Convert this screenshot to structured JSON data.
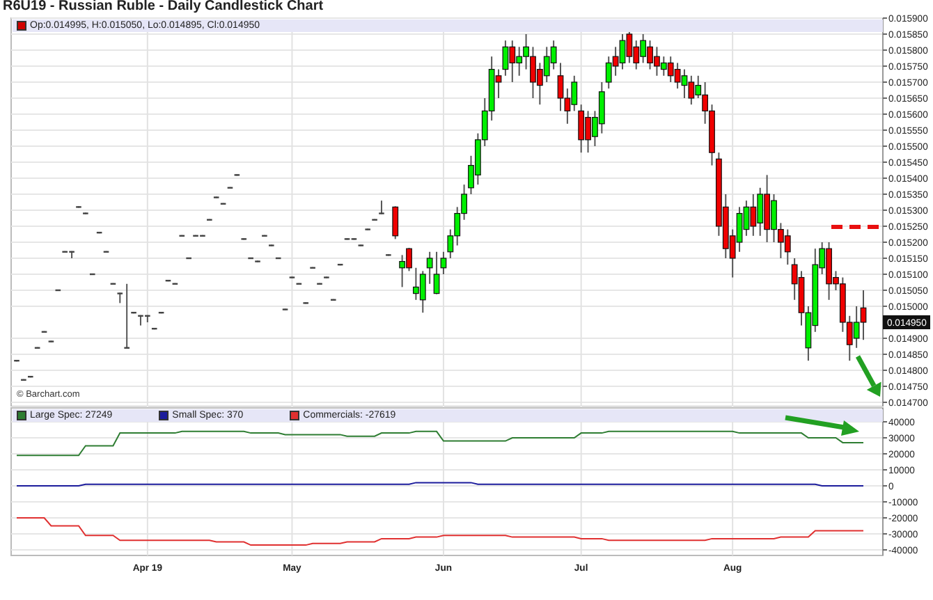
{
  "title": "R6U19 - Russian Ruble - Daily Candlestick Chart",
  "price_chart": {
    "readout": "Op:0.014995, H:0.015050, Lo:0.014895, Cl:0.014950",
    "credit": "© Barchart.com",
    "chart_data": {
      "type": "candlestick",
      "grid": true,
      "ylim": [
        0.0147,
        0.0159
      ],
      "categories": [
        null,
        null,
        null,
        null,
        null,
        null,
        null,
        null,
        null,
        null,
        null,
        null,
        null,
        null,
        null,
        null,
        null,
        null,
        null,
        null,
        null,
        null,
        null,
        null,
        null,
        null,
        null,
        null,
        null,
        null,
        null,
        null,
        null,
        null,
        null,
        null,
        null,
        null,
        null,
        null,
        null,
        null,
        null,
        null,
        null,
        null,
        null,
        null,
        null,
        null,
        null,
        null,
        null,
        null,
        null,
        null,
        null,
        null,
        null,
        null,
        null,
        null,
        null,
        null,
        null,
        null,
        null,
        null,
        null,
        null,
        null,
        null,
        null,
        null,
        null,
        null,
        null,
        null,
        null,
        null,
        null,
        null,
        null,
        null,
        null,
        null,
        null,
        null,
        null,
        null,
        null,
        null,
        null,
        null,
        null,
        null,
        null,
        null,
        null,
        null,
        null,
        null,
        null,
        null,
        null,
        null,
        null,
        null,
        null,
        null,
        null,
        null,
        null,
        null,
        null,
        null,
        null,
        null,
        null,
        null,
        null,
        null,
        null,
        null
      ],
      "yticks": [
        {
          "value": 0.0159,
          "label": "0.015900"
        },
        {
          "value": 0.01585,
          "label": "0.015850"
        },
        {
          "value": 0.0158,
          "label": "0.015800"
        },
        {
          "value": 0.01575,
          "label": "0.015750"
        },
        {
          "value": 0.0157,
          "label": "0.015700"
        },
        {
          "value": 0.01565,
          "label": "0.015650"
        },
        {
          "value": 0.0156,
          "label": "0.015600"
        },
        {
          "value": 0.01555,
          "label": "0.015550"
        },
        {
          "value": 0.0155,
          "label": "0.015500"
        },
        {
          "value": 0.01545,
          "label": "0.015450"
        },
        {
          "value": 0.0154,
          "label": "0.015400"
        },
        {
          "value": 0.01535,
          "label": "0.015350"
        },
        {
          "value": 0.0153,
          "label": "0.015300"
        },
        {
          "value": 0.01525,
          "label": "0.015250"
        },
        {
          "value": 0.0152,
          "label": "0.015200"
        },
        {
          "value": 0.01515,
          "label": "0.015150"
        },
        {
          "value": 0.0151,
          "label": "0.015100"
        },
        {
          "value": 0.01505,
          "label": "0.015050"
        },
        {
          "value": 0.015,
          "label": "0.015000"
        },
        {
          "value": 0.0149,
          "label": "0.014900"
        },
        {
          "value": 0.01485,
          "label": "0.014850"
        },
        {
          "value": 0.0148,
          "label": "0.014800"
        },
        {
          "value": 0.01475,
          "label": "0.014750"
        },
        {
          "value": 0.0147,
          "label": "0.014700"
        }
      ],
      "ohlc": [
        [
          0.01483,
          0.01483,
          0.01483,
          0.01483
        ],
        [
          0.01477,
          0.01477,
          0.01477,
          0.01477
        ],
        [
          0.01478,
          0.01478,
          0.01478,
          0.01478
        ],
        [
          0.01487,
          0.01487,
          0.01487,
          0.01487
        ],
        [
          0.01492,
          0.01492,
          0.01492,
          0.01492
        ],
        [
          0.01489,
          0.01489,
          0.01489,
          0.01489
        ],
        [
          0.01505,
          0.01505,
          0.01505,
          0.01505
        ],
        [
          0.01517,
          0.01517,
          0.01517,
          0.01517
        ],
        [
          0.01517,
          0.01517,
          0.01515,
          0.01517
        ],
        [
          0.01531,
          0.01531,
          0.01531,
          0.01531
        ],
        [
          0.01529,
          0.01529,
          0.01529,
          0.01529
        ],
        [
          0.0151,
          0.0151,
          0.0151,
          0.0151
        ],
        [
          0.01523,
          0.01523,
          0.01523,
          0.01523
        ],
        [
          0.01517,
          0.01517,
          0.01517,
          0.01517
        ],
        [
          0.01507,
          0.01507,
          0.01507,
          0.01507
        ],
        [
          0.01504,
          0.01504,
          0.01501,
          0.01504
        ],
        [
          0.01487,
          0.01507,
          0.01487,
          0.01487
        ],
        [
          0.01498,
          0.01498,
          0.01498,
          0.01498
        ],
        [
          0.01497,
          0.01497,
          0.01494,
          0.01497
        ],
        [
          0.01497,
          0.01497,
          0.01495,
          0.01497
        ],
        [
          0.01493,
          0.01493,
          0.01493,
          0.01493
        ],
        [
          0.01498,
          0.01498,
          0.01498,
          0.01498
        ],
        [
          0.01508,
          0.01508,
          0.01508,
          0.01508
        ],
        [
          0.01507,
          0.01507,
          0.01507,
          0.01507
        ],
        [
          0.01522,
          0.01522,
          0.01522,
          0.01522
        ],
        [
          0.01515,
          0.01515,
          0.01515,
          0.01515
        ],
        [
          0.01522,
          0.01522,
          0.01522,
          0.01522
        ],
        [
          0.01522,
          0.01522,
          0.01522,
          0.01522
        ],
        [
          0.01527,
          0.01527,
          0.01527,
          0.01527
        ],
        [
          0.01534,
          0.01534,
          0.01534,
          0.01534
        ],
        [
          0.01532,
          0.01532,
          0.01532,
          0.01532
        ],
        [
          0.01537,
          0.01537,
          0.01537,
          0.01537
        ],
        [
          0.01541,
          0.01541,
          0.01541,
          0.01541
        ],
        [
          0.01521,
          0.01521,
          0.01521,
          0.01521
        ],
        [
          0.01515,
          0.01515,
          0.01515,
          0.01515
        ],
        [
          0.01514,
          0.01514,
          0.01514,
          0.01514
        ],
        [
          0.01522,
          0.01522,
          0.01522,
          0.01522
        ],
        [
          0.01519,
          0.01519,
          0.01519,
          0.01519
        ],
        [
          0.01515,
          0.01515,
          0.01515,
          0.01515
        ],
        [
          0.01499,
          0.01499,
          0.01499,
          0.01499
        ],
        [
          0.01509,
          0.01509,
          0.01509,
          0.01509
        ],
        [
          0.01507,
          0.01507,
          0.01507,
          0.01507
        ],
        [
          0.01501,
          0.01501,
          0.01501,
          0.01501
        ],
        [
          0.01512,
          0.01512,
          0.01512,
          0.01512
        ],
        [
          0.01507,
          0.01507,
          0.01507,
          0.01507
        ],
        [
          0.01509,
          0.01509,
          0.01509,
          0.01509
        ],
        [
          0.01502,
          0.01502,
          0.01502,
          0.01502
        ],
        [
          0.01513,
          0.01513,
          0.01513,
          0.01513
        ],
        [
          0.01521,
          0.01521,
          0.01521,
          0.01521
        ],
        [
          0.01521,
          0.01521,
          0.01521,
          0.01521
        ],
        [
          0.01519,
          0.01519,
          0.01519,
          0.01519
        ],
        [
          0.01524,
          0.01524,
          0.01524,
          0.01524
        ],
        [
          0.01527,
          0.01527,
          0.01527,
          0.01527
        ],
        [
          0.01529,
          0.01533,
          0.01529,
          0.01529
        ],
        [
          0.01516,
          0.01516,
          0.01516,
          0.01516
        ],
        [
          0.01531,
          0.01531,
          0.01521,
          0.01522
        ],
        [
          0.01512,
          0.01516,
          0.01506,
          0.01514
        ],
        [
          0.01518,
          0.01518,
          0.01511,
          0.01512
        ],
        [
          0.01504,
          0.01512,
          0.01502,
          0.01506
        ],
        [
          0.01502,
          0.01511,
          0.01498,
          0.0151
        ],
        [
          0.01512,
          0.01517,
          0.01507,
          0.01515
        ],
        [
          0.01504,
          0.01517,
          0.01504,
          0.0151
        ],
        [
          0.01512,
          0.01517,
          0.0151,
          0.01515
        ],
        [
          0.01517,
          0.01524,
          0.01515,
          0.01522
        ],
        [
          0.01522,
          0.01531,
          0.01519,
          0.01529
        ],
        [
          0.01529,
          0.01538,
          0.01527,
          0.01535
        ],
        [
          0.01537,
          0.01547,
          0.01535,
          0.01544
        ],
        [
          0.01541,
          0.01554,
          0.01538,
          0.01552
        ],
        [
          0.01552,
          0.01565,
          0.0155,
          0.01561
        ],
        [
          0.01561,
          0.01578,
          0.01558,
          0.01574
        ],
        [
          0.01572,
          0.01574,
          0.01565,
          0.0157
        ],
        [
          0.01574,
          0.01583,
          0.01572,
          0.01581
        ],
        [
          0.01581,
          0.01583,
          0.0157,
          0.01576
        ],
        [
          0.01576,
          0.01581,
          0.01572,
          0.01578
        ],
        [
          0.01578,
          0.01585,
          0.01574,
          0.01581
        ],
        [
          0.01578,
          0.01581,
          0.01565,
          0.0157
        ],
        [
          0.01574,
          0.01576,
          0.01563,
          0.01569
        ],
        [
          0.01572,
          0.01581,
          0.0157,
          0.01578
        ],
        [
          0.01576,
          0.01583,
          0.01574,
          0.01581
        ],
        [
          0.01572,
          0.01576,
          0.01561,
          0.01565
        ],
        [
          0.01565,
          0.01568,
          0.01557,
          0.01561
        ],
        [
          0.01563,
          0.01572,
          0.01561,
          0.0157
        ],
        [
          0.01561,
          0.01563,
          0.01548,
          0.01552
        ],
        [
          0.01559,
          0.01561,
          0.01548,
          0.01552
        ],
        [
          0.01553,
          0.01561,
          0.0155,
          0.01559
        ],
        [
          0.01557,
          0.0157,
          0.01554,
          0.01567
        ],
        [
          0.0157,
          0.01578,
          0.01568,
          0.01576
        ],
        [
          0.01578,
          0.01581,
          0.01572,
          0.01575
        ],
        [
          0.01576,
          0.01585,
          0.01574,
          0.01583
        ],
        [
          0.01585,
          0.01586,
          0.01576,
          0.01578
        ],
        [
          0.01581,
          0.01583,
          0.01574,
          0.01576
        ],
        [
          0.01578,
          0.01585,
          0.01576,
          0.01583
        ],
        [
          0.01581,
          0.01583,
          0.01574,
          0.01576
        ],
        [
          0.01578,
          0.01581,
          0.01572,
          0.01575
        ],
        [
          0.01574,
          0.01578,
          0.01572,
          0.01576
        ],
        [
          0.01576,
          0.01578,
          0.0157,
          0.01572
        ],
        [
          0.01574,
          0.01576,
          0.01568,
          0.0157
        ],
        [
          0.01569,
          0.01574,
          0.01565,
          0.01572
        ],
        [
          0.0157,
          0.01572,
          0.01563,
          0.01565
        ],
        [
          0.01566,
          0.01572,
          0.01565,
          0.01569
        ],
        [
          0.01566,
          0.0157,
          0.01557,
          0.01561
        ],
        [
          0.01561,
          0.01563,
          0.01544,
          0.01548
        ],
        [
          0.01546,
          0.01548,
          0.01522,
          0.01525
        ],
        [
          0.01531,
          0.01535,
          0.01515,
          0.01518
        ],
        [
          0.01522,
          0.01524,
          0.01509,
          0.01515
        ],
        [
          0.0152,
          0.01531,
          0.01517,
          0.01529
        ],
        [
          0.01524,
          0.01533,
          0.01522,
          0.01531
        ],
        [
          0.01531,
          0.01535,
          0.01522,
          0.01525
        ],
        [
          0.01526,
          0.01537,
          0.01522,
          0.01535
        ],
        [
          0.01535,
          0.01541,
          0.0152,
          0.01524
        ],
        [
          0.01524,
          0.01535,
          0.0152,
          0.01533
        ],
        [
          0.01524,
          0.01526,
          0.01515,
          0.0152
        ],
        [
          0.01522,
          0.01524,
          0.01513,
          0.01517
        ],
        [
          0.01513,
          0.01515,
          0.01502,
          0.01507
        ],
        [
          0.01509,
          0.01511,
          0.01494,
          0.01498
        ],
        [
          0.01487,
          0.015,
          0.01483,
          0.01498
        ],
        [
          0.01494,
          0.01518,
          0.01492,
          0.01513
        ],
        [
          0.01512,
          0.0152,
          0.0151,
          0.01518
        ],
        [
          0.01518,
          0.0152,
          0.01502,
          0.01507
        ],
        [
          0.01509,
          0.01511,
          0.01505,
          0.01507
        ],
        [
          0.01507,
          0.01509,
          0.01492,
          0.01495
        ],
        [
          0.01495,
          0.01497,
          0.01483,
          0.01488
        ],
        [
          0.0149,
          0.015,
          0.01487,
          0.01495
        ],
        [
          0.014995,
          0.01505,
          0.014895,
          0.01495
        ]
      ],
      "annotations": [
        "0.014950"
      ]
    }
  },
  "cot_chart": {
    "chart_data": {
      "type": "line",
      "grid": true,
      "ylim": [
        -40000,
        40000
      ],
      "categories": [
        null,
        null,
        null,
        null,
        null,
        null,
        null,
        null,
        null,
        null,
        null,
        null,
        null,
        null,
        null,
        null,
        null,
        null,
        null,
        "Apr 19",
        null,
        null,
        null,
        null,
        null,
        null,
        null,
        null,
        null,
        null,
        null,
        null,
        null,
        null,
        null,
        null,
        null,
        null,
        null,
        null,
        "May",
        null,
        null,
        null,
        null,
        null,
        null,
        null,
        null,
        null,
        null,
        null,
        null,
        null,
        null,
        null,
        null,
        null,
        null,
        null,
        null,
        null,
        "Jun",
        null,
        null,
        null,
        null,
        null,
        null,
        null,
        null,
        null,
        null,
        null,
        null,
        null,
        null,
        null,
        null,
        null,
        null,
        null,
        "Jul",
        null,
        null,
        null,
        null,
        null,
        null,
        null,
        null,
        null,
        null,
        null,
        null,
        null,
        null,
        null,
        null,
        null,
        null,
        null,
        null,
        null,
        "Aug",
        null,
        null,
        null,
        null,
        null,
        null,
        null,
        null,
        null,
        null,
        null,
        null,
        null,
        null,
        null,
        null,
        null,
        null,
        null
      ],
      "yticks": [
        40000,
        30000,
        20000,
        10000,
        0,
        -10000,
        -20000,
        -30000,
        -40000
      ],
      "series": [
        {
          "name": "Large Spec: 27249",
          "color": "#2e7d32",
          "values": [
            19000,
            19000,
            19000,
            19000,
            19000,
            19000,
            19000,
            19000,
            19000,
            19000,
            25000,
            25000,
            25000,
            25000,
            25000,
            33000,
            33000,
            33000,
            33000,
            33000,
            33000,
            33000,
            33000,
            33000,
            34000,
            34000,
            34000,
            34000,
            34000,
            34000,
            34000,
            34000,
            34000,
            34000,
            33000,
            33000,
            33000,
            33000,
            33000,
            32000,
            32000,
            32000,
            32000,
            32000,
            32000,
            32000,
            32000,
            32000,
            31000,
            31000,
            31000,
            31000,
            31000,
            33000,
            33000,
            33000,
            33000,
            33000,
            34000,
            34000,
            34000,
            34000,
            28000,
            28000,
            28000,
            28000,
            28000,
            28000,
            28000,
            28000,
            28000,
            28000,
            30000,
            30000,
            30000,
            30000,
            30000,
            30000,
            30000,
            30000,
            30000,
            30000,
            33000,
            33000,
            33000,
            33000,
            34000,
            34000,
            34000,
            34000,
            34000,
            34000,
            34000,
            34000,
            34000,
            34000,
            34000,
            34000,
            34000,
            34000,
            34000,
            34000,
            34000,
            34000,
            34000,
            33000,
            33000,
            33000,
            33000,
            33000,
            33000,
            33000,
            33000,
            33000,
            33000,
            30000,
            30000,
            30000,
            30000,
            30000,
            27000,
            27000,
            27000,
            27000
          ]
        },
        {
          "name": "Small Spec: 370",
          "color": "#1c1c9c",
          "values": [
            0,
            0,
            0,
            0,
            0,
            0,
            0,
            0,
            0,
            0,
            1000,
            1000,
            1000,
            1000,
            1000,
            1000,
            1000,
            1000,
            1000,
            1000,
            1000,
            1000,
            1000,
            1000,
            1000,
            1000,
            1000,
            1000,
            1000,
            1000,
            1000,
            1000,
            1000,
            1000,
            1000,
            1000,
            1000,
            1000,
            1000,
            1000,
            1000,
            1000,
            1000,
            1000,
            1000,
            1000,
            1000,
            1000,
            1000,
            1000,
            1000,
            1000,
            1000,
            1000,
            1000,
            1000,
            1000,
            1000,
            2000,
            2000,
            2000,
            2000,
            2000,
            2000,
            2000,
            2000,
            2000,
            1000,
            1000,
            1000,
            1000,
            1000,
            1000,
            1000,
            1000,
            1000,
            1000,
            1000,
            1000,
            1000,
            1000,
            1000,
            1000,
            1000,
            1000,
            1000,
            1000,
            1000,
            1000,
            1000,
            1000,
            1000,
            1000,
            1000,
            1000,
            1000,
            1000,
            1000,
            1000,
            1000,
            1000,
            1000,
            1000,
            1000,
            1000,
            1000,
            1000,
            1000,
            1000,
            1000,
            1000,
            1000,
            1000,
            1000,
            1000,
            1000,
            1000,
            0,
            0,
            0,
            0,
            0,
            0,
            0
          ]
        },
        {
          "name": "Commercials: -27619",
          "color": "#e03030",
          "values": [
            -20000,
            -20000,
            -20000,
            -20000,
            -20000,
            -25000,
            -25000,
            -25000,
            -25000,
            -25000,
            -31000,
            -31000,
            -31000,
            -31000,
            -31000,
            -34000,
            -34000,
            -34000,
            -34000,
            -34000,
            -34000,
            -34000,
            -34000,
            -34000,
            -34000,
            -34000,
            -34000,
            -34000,
            -34000,
            -35000,
            -35000,
            -35000,
            -35000,
            -35000,
            -37000,
            -37000,
            -37000,
            -37000,
            -37000,
            -37000,
            -37000,
            -37000,
            -37000,
            -36000,
            -36000,
            -36000,
            -36000,
            -36000,
            -35000,
            -35000,
            -35000,
            -35000,
            -35000,
            -33000,
            -33000,
            -33000,
            -33000,
            -33000,
            -32000,
            -32000,
            -32000,
            -32000,
            -31000,
            -31000,
            -31000,
            -31000,
            -31000,
            -31000,
            -31000,
            -31000,
            -31000,
            -31000,
            -32000,
            -32000,
            -32000,
            -32000,
            -32000,
            -32000,
            -32000,
            -32000,
            -32000,
            -32000,
            -33000,
            -33000,
            -33000,
            -33000,
            -34000,
            -34000,
            -34000,
            -34000,
            -34000,
            -34000,
            -34000,
            -34000,
            -34000,
            -34000,
            -34000,
            -34000,
            -34000,
            -34000,
            -34000,
            -33000,
            -33000,
            -33000,
            -33000,
            -33000,
            -33000,
            -33000,
            -33000,
            -33000,
            -33000,
            -32000,
            -32000,
            -32000,
            -32000,
            -32000,
            -28000,
            -28000,
            -28000,
            -28000,
            -28000,
            -28000,
            -28000,
            -28000
          ]
        }
      ]
    }
  }
}
